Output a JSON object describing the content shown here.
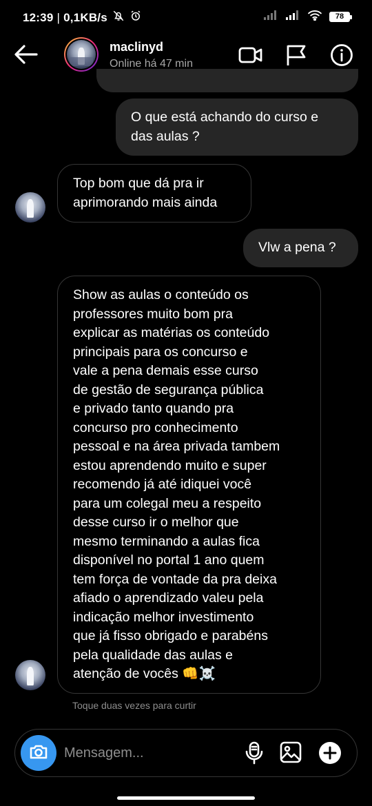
{
  "status_bar": {
    "time": "12:39",
    "network_speed": "0,1KB/s",
    "battery": "78",
    "icons": [
      "mute-icon",
      "alarm-icon",
      "signal-icon",
      "signal-icon",
      "wifi-icon",
      "battery-icon"
    ]
  },
  "header": {
    "username": "maclinyd",
    "online_status": "Online há 47 min",
    "icons": [
      "back-arrow-icon",
      "video-call-icon",
      "flag-icon",
      "info-icon"
    ]
  },
  "messages": [
    {
      "direction": "outgoing",
      "text": "O que está achando do curso e\ndas aulas ?"
    },
    {
      "direction": "incoming",
      "text": "Top bom que dá pra ir\naprimorando mais ainda"
    },
    {
      "direction": "outgoing",
      "text": "Vlw a pena ?"
    },
    {
      "direction": "incoming",
      "text": "Show as aulas o conteúdo os\nprofessores muito bom pra\nexplicar as matérias os conteúdo\nprincipais para os concurso e\nvale a pena demais esse curso\nde gestão de segurança pública\ne privado tanto quando pra\nconcurso pro conhecimento\npessoal e na área privada tambem\nestou aprendendo muito e super\nrecomendo já até idiquei você\npara um colegal meu a respeito\ndesse curso ir o melhor que\nmesmo terminando a aulas fica\ndisponível no portal 1 ano quem\ntem força de vontade da pra deixa\nafiado o aprendizado valeu pela\nindicação melhor investimento\nque já fisso obrigado e parabéns\npela qualidade das aulas e\natenção de vocês 👊☠️"
    }
  ],
  "hint": "Toque duas vezes para curtir",
  "composer": {
    "placeholder": "Mensagem...",
    "icons": [
      "camera-icon",
      "microphone-icon",
      "gallery-icon",
      "plus-icon"
    ]
  }
}
